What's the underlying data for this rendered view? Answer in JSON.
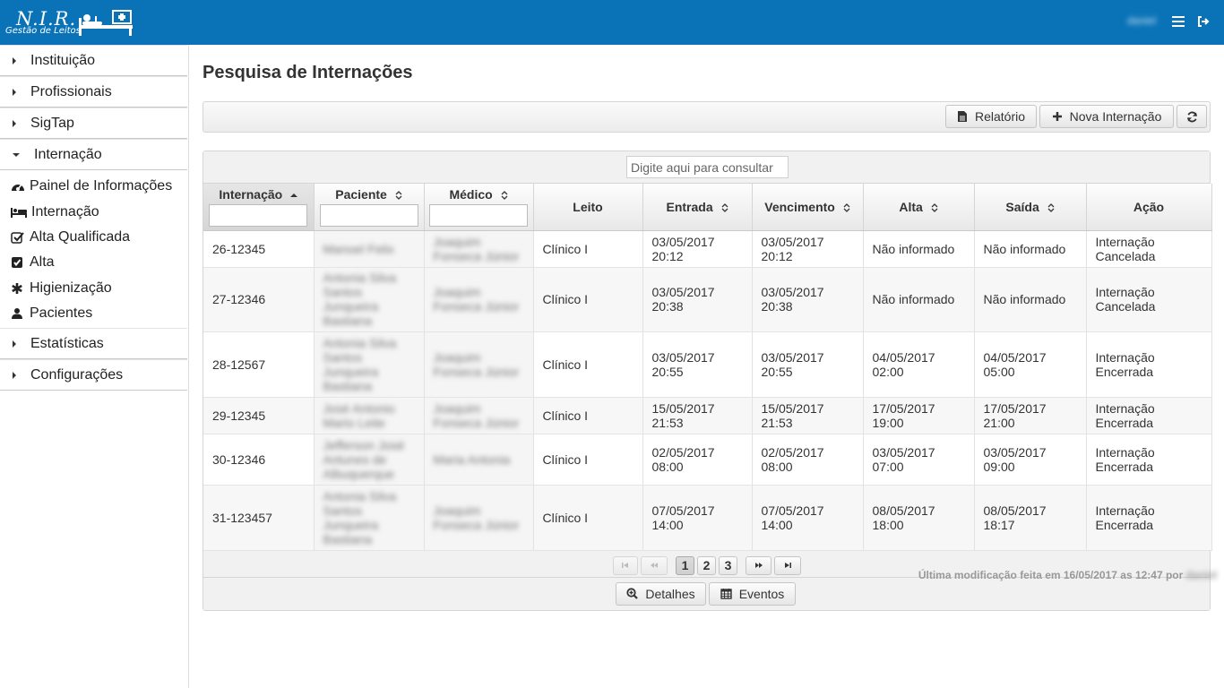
{
  "app": {
    "logo_title": "N.I.R.",
    "logo_subtitle": "Gestão de Leitos",
    "user_name": "daniel"
  },
  "sidebar": {
    "groups": [
      {
        "label": "Instituição",
        "expanded": false
      },
      {
        "label": "Profissionais",
        "expanded": false
      },
      {
        "label": "SigTap",
        "expanded": false
      },
      {
        "label": "Internação",
        "expanded": true
      },
      {
        "label": "Estatísticas",
        "expanded": false
      },
      {
        "label": "Configurações",
        "expanded": false
      }
    ],
    "internacao_items": [
      {
        "label": "Painel de Informações",
        "icon": "dashboard-icon"
      },
      {
        "label": "Internação",
        "icon": "bed-icon"
      },
      {
        "label": "Alta Qualificada",
        "icon": "check-square-outline-icon"
      },
      {
        "label": "Alta",
        "icon": "check-square-icon"
      },
      {
        "label": "Higienização",
        "icon": "asterisk-icon"
      },
      {
        "label": "Pacientes",
        "icon": "user-icon"
      }
    ]
  },
  "main": {
    "page_title": "Pesquisa de Internações",
    "toolbar": {
      "report_label": "Relatório",
      "new_label": "Nova Internação"
    },
    "search_placeholder": "Digite aqui para consultar",
    "columns": [
      "Internação",
      "Paciente",
      "Médico",
      "Leito",
      "Entrada",
      "Vencimento",
      "Alta",
      "Saída",
      "Ação"
    ],
    "rows": [
      {
        "internacao": "26-12345",
        "paciente": [
          "Manoel Felix"
        ],
        "medico": [
          "Joaquim",
          "Fonseca Júnior"
        ],
        "leito": "Clínico I",
        "entrada": [
          "03/05/2017",
          "20:12"
        ],
        "vencimento": [
          "03/05/2017",
          "20:12"
        ],
        "alta": [
          "Não informado"
        ],
        "saida": [
          "Não informado"
        ],
        "acao": [
          "Internação",
          "Cancelada"
        ]
      },
      {
        "internacao": "27-12346",
        "paciente": [
          "Antonia Silva",
          "Santos",
          "Junqueira",
          "Bastiana"
        ],
        "medico": [
          "Joaquim",
          "Fonseca Júnior"
        ],
        "leito": "Clínico I",
        "entrada": [
          "03/05/2017",
          "20:38"
        ],
        "vencimento": [
          "03/05/2017",
          "20:38"
        ],
        "alta": [
          "Não informado"
        ],
        "saida": [
          "Não informado"
        ],
        "acao": [
          "Internação",
          "Cancelada"
        ]
      },
      {
        "internacao": "28-12567",
        "paciente": [
          "Antonia Silva",
          "Santos",
          "Junqueira",
          "Bastiana"
        ],
        "medico": [
          "Joaquim",
          "Fonseca Júnior"
        ],
        "leito": "Clínico I",
        "entrada": [
          "03/05/2017",
          "20:55"
        ],
        "vencimento": [
          "03/05/2017",
          "20:55"
        ],
        "alta": [
          "04/05/2017",
          "02:00"
        ],
        "saida": [
          "04/05/2017",
          "05:00"
        ],
        "acao": [
          "Internação",
          "Encerrada"
        ]
      },
      {
        "internacao": "29-12345",
        "paciente": [
          "José Antonio",
          "Mario Leite"
        ],
        "medico": [
          "Joaquim",
          "Fonseca Júnior"
        ],
        "leito": "Clínico I",
        "entrada": [
          "15/05/2017",
          "21:53"
        ],
        "vencimento": [
          "15/05/2017",
          "21:53"
        ],
        "alta": [
          "17/05/2017",
          "19:00"
        ],
        "saida": [
          "17/05/2017",
          "21:00"
        ],
        "acao": [
          "Internação",
          "Encerrada"
        ]
      },
      {
        "internacao": "30-12346",
        "paciente": [
          "Jefferson José",
          "Antunes de",
          "Albuquerque"
        ],
        "medico": [
          "Maria Antonia"
        ],
        "leito": "Clínico I",
        "entrada": [
          "02/05/2017",
          "08:00"
        ],
        "vencimento": [
          "02/05/2017",
          "08:00"
        ],
        "alta": [
          "03/05/2017",
          "07:00"
        ],
        "saida": [
          "03/05/2017",
          "09:00"
        ],
        "acao": [
          "Internação",
          "Encerrada"
        ]
      },
      {
        "internacao": "31-123457",
        "paciente": [
          "Antonia Silva",
          "Santos",
          "Junqueira",
          "Bastiana"
        ],
        "medico": [
          "Joaquim",
          "Fonseca Júnior"
        ],
        "leito": "Clínico I",
        "entrada": [
          "07/05/2017",
          "14:00"
        ],
        "vencimento": [
          "07/05/2017",
          "14:00"
        ],
        "alta": [
          "08/05/2017",
          "18:00"
        ],
        "saida": [
          "08/05/2017",
          "18:17"
        ],
        "acao": [
          "Internação",
          "Encerrada"
        ]
      }
    ],
    "pagination": {
      "first": "⏮",
      "prev": "«",
      "pages": [
        "1",
        "2",
        "3"
      ],
      "current": "1",
      "next": "»",
      "last": "⏭"
    },
    "footer_buttons": {
      "details_label": "Detalhes",
      "events_label": "Eventos"
    },
    "last_modified": "Última modificação feita em 16/05/2017 as 12:47 por",
    "last_modified_user": "daniel"
  },
  "colors": {
    "topbar": "#0a73b8"
  }
}
